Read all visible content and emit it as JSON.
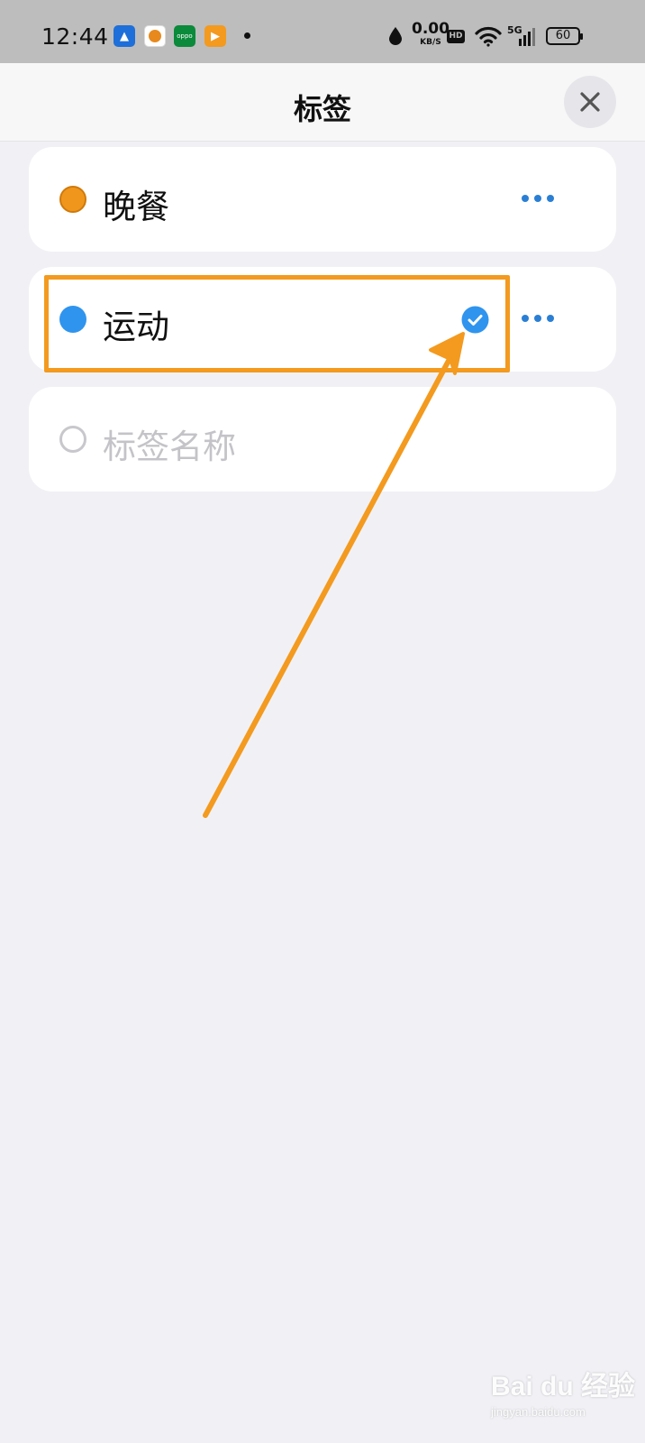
{
  "status_bar": {
    "time": "12:44",
    "net_speed": "0.00",
    "net_unit": "KB/S",
    "hd": "HD",
    "signal": "5G",
    "battery": "60"
  },
  "header": {
    "title": "标签"
  },
  "tags": [
    {
      "label": "晚餐",
      "color": "#f0961c",
      "selected": false
    },
    {
      "label": "运动",
      "color": "#2f94ee",
      "selected": true
    }
  ],
  "new_tag": {
    "placeholder": "标签名称"
  },
  "annotation": {
    "color": "#f39a1f"
  },
  "watermark": {
    "logo": "Bai du 经验",
    "url": "jingyan.baidu.com"
  }
}
